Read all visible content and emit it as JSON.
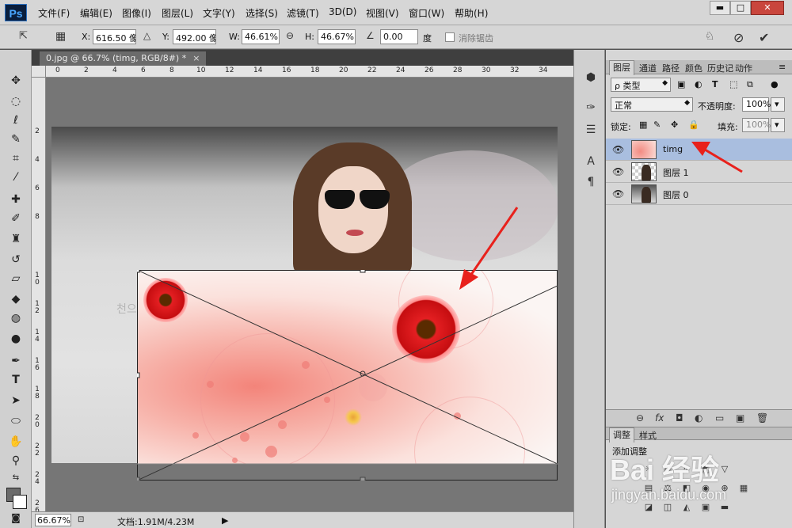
{
  "app": {
    "logo": "Ps"
  },
  "menu": [
    "文件(F)",
    "编辑(E)",
    "图像(I)",
    "图层(L)",
    "文字(Y)",
    "选择(S)",
    "滤镜(T)",
    "3D(D)",
    "视图(V)",
    "窗口(W)",
    "帮助(H)"
  ],
  "window_controls": {
    "minimize": "▬",
    "maximize": "□",
    "close": "✕"
  },
  "options": {
    "x_label": "X:",
    "x_value": "616.50 像",
    "y_label": "Y:",
    "y_value": "492.00 像",
    "w_label": "W:",
    "w_value": "46.61%",
    "h_label": "H:",
    "h_value": "46.67%",
    "angle_value": "0.00",
    "angle_unit": "度",
    "antialias_label": "消除锯齿",
    "cancel_icon": "⊘",
    "commit_icon": "✔"
  },
  "document": {
    "tab_title": "0.jpg @ 66.7% (timg, RGB/8#) *",
    "close": "×"
  },
  "ruler_top": [
    "0",
    "2",
    "4",
    "6",
    "8",
    "10",
    "12",
    "14",
    "16",
    "18",
    "20",
    "22",
    "24",
    "26",
    "28",
    "30",
    "32",
    "34"
  ],
  "ruler_left": [
    "2",
    "4",
    "6",
    "8",
    "1 0",
    "1 2",
    "1 4",
    "1 6",
    "1 8",
    "2 0",
    "2 2",
    "2 4",
    "2 6"
  ],
  "canvas_text": "천으",
  "status": {
    "zoom": "66.67%",
    "doc_info": "文档:1.91M/4.23M"
  },
  "panel_tabs": [
    "图层",
    "通道",
    "路径",
    "颜色",
    "历史记",
    "动作"
  ],
  "layers": {
    "filter_label": "ρ 类型",
    "blend_mode": "正常",
    "opacity_label": "不透明度:",
    "opacity_value": "100%",
    "lock_label": "锁定:",
    "fill_label": "填充:",
    "fill_value": "100%",
    "items": [
      {
        "name": "timg",
        "selected": true
      },
      {
        "name": "图层 1",
        "selected": false
      },
      {
        "name": "图层 0",
        "selected": false
      }
    ],
    "footer_icons": [
      "⊖",
      "fx",
      "◘",
      "◐",
      "▭",
      "▣",
      "🗑"
    ]
  },
  "adjust": {
    "tabs": [
      "调整",
      "样式"
    ],
    "title": "添加调整"
  },
  "watermark": {
    "main": "Bai 经验",
    "url": "jingyan.baidu.com"
  },
  "colors": {
    "menu_bg": "#d6d6d6",
    "selected_layer": "#a9bedf",
    "arrow": "#e8211c"
  }
}
